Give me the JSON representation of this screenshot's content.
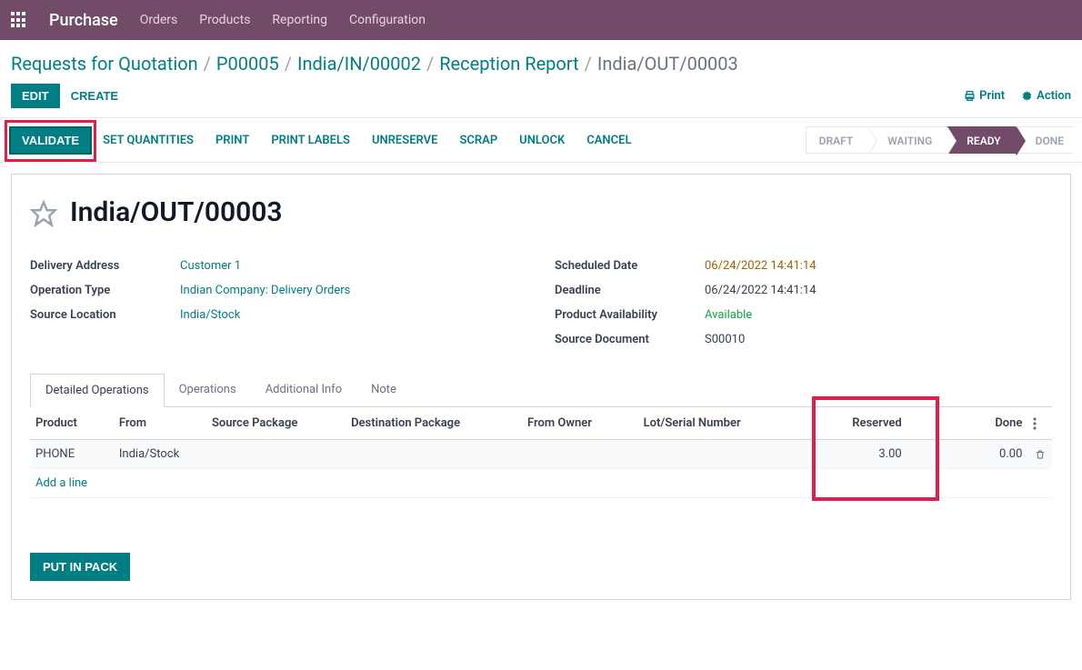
{
  "nav": {
    "app": "Purchase",
    "items": [
      "Orders",
      "Products",
      "Reporting",
      "Configuration"
    ]
  },
  "breadcrumb": {
    "items": [
      "Requests for Quotation",
      "P00005",
      "India/IN/00002",
      "Reception Report"
    ],
    "current": "India/OUT/00003"
  },
  "buttons": {
    "edit": "EDIT",
    "create": "CREATE",
    "print": "Print",
    "action": "Action",
    "validate": "VALIDATE",
    "set_quantities": "SET QUANTITIES",
    "print2": "PRINT",
    "print_labels": "PRINT LABELS",
    "unreserve": "UNRESERVE",
    "scrap": "SCRAP",
    "unlock": "UNLOCK",
    "cancel": "CANCEL",
    "put_in_pack": "PUT IN PACK"
  },
  "status": {
    "draft": "DRAFT",
    "waiting": "WAITING",
    "ready": "READY",
    "done": "DONE"
  },
  "record": {
    "title": "India/OUT/00003",
    "fields_left": {
      "delivery_address_label": "Delivery Address",
      "delivery_address_value": "Customer 1",
      "operation_type_label": "Operation Type",
      "operation_type_value": "Indian Company: Delivery Orders",
      "source_location_label": "Source Location",
      "source_location_value": "India/Stock"
    },
    "fields_right": {
      "scheduled_date_label": "Scheduled Date",
      "scheduled_date_value": "06/24/2022 14:41:14",
      "deadline_label": "Deadline",
      "deadline_value": "06/24/2022 14:41:14",
      "product_availability_label": "Product Availability",
      "product_availability_value": "Available",
      "source_document_label": "Source Document",
      "source_document_value": "S00010"
    }
  },
  "tabs": {
    "detailed_operations": "Detailed Operations",
    "operations": "Operations",
    "additional_info": "Additional Info",
    "note": "Note"
  },
  "table": {
    "headers": {
      "product": "Product",
      "from": "From",
      "source_package": "Source Package",
      "destination_package": "Destination Package",
      "from_owner": "From Owner",
      "lot_serial": "Lot/Serial Number",
      "reserved": "Reserved",
      "done": "Done"
    },
    "rows": [
      {
        "product": "PHONE",
        "from": "India/Stock",
        "source_package": "",
        "destination_package": "",
        "from_owner": "",
        "lot_serial": "",
        "reserved": "3.00",
        "done": "0.00"
      }
    ],
    "add_line": "Add a line"
  }
}
